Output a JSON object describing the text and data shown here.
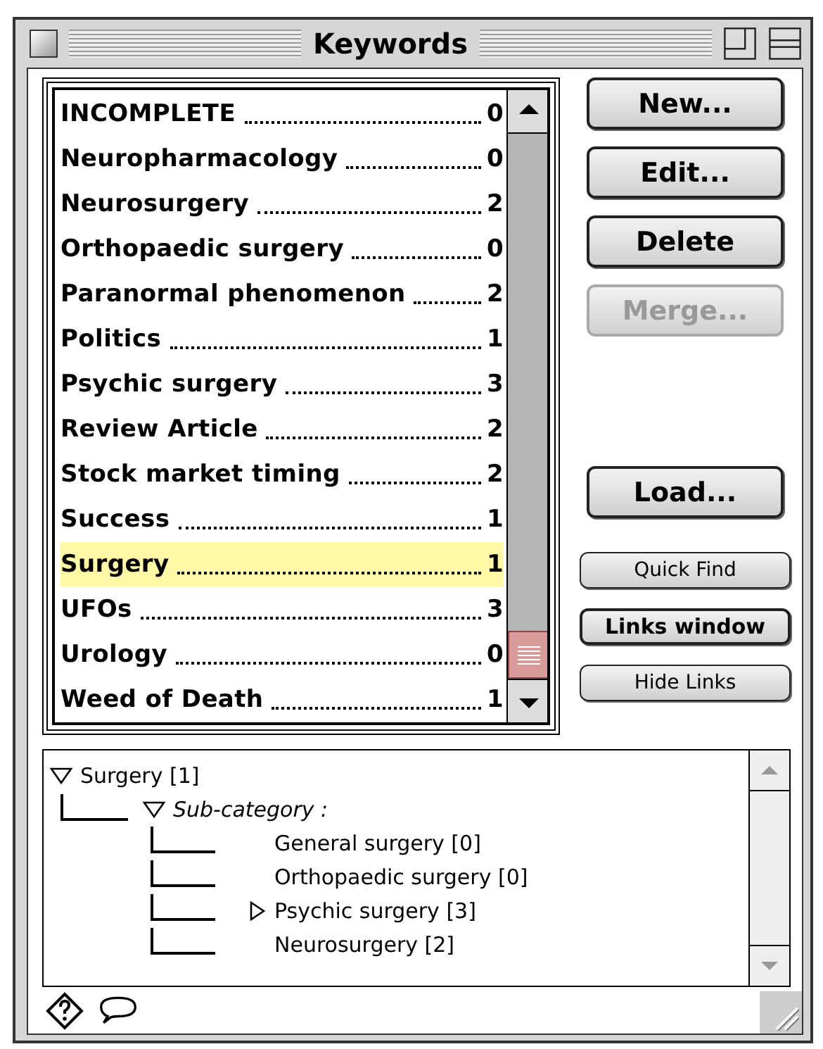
{
  "window": {
    "title": "Keywords"
  },
  "keywords": [
    {
      "name": "INCOMPLETE",
      "count": "0",
      "selected": false
    },
    {
      "name": "Neuropharmacology",
      "count": "0",
      "selected": false
    },
    {
      "name": "Neurosurgery",
      "count": "2",
      "selected": false
    },
    {
      "name": "Orthopaedic surgery",
      "count": "0",
      "selected": false
    },
    {
      "name": "Paranormal phenomenon",
      "count": "2",
      "selected": false
    },
    {
      "name": "Politics",
      "count": "1",
      "selected": false
    },
    {
      "name": "Psychic surgery",
      "count": "3",
      "selected": false
    },
    {
      "name": "Review Article",
      "count": "2",
      "selected": false
    },
    {
      "name": "Stock market timing",
      "count": "2",
      "selected": false
    },
    {
      "name": "Success",
      "count": "1",
      "selected": false
    },
    {
      "name": "Surgery",
      "count": "1",
      "selected": true
    },
    {
      "name": "UFOs",
      "count": "3",
      "selected": false
    },
    {
      "name": "Urology",
      "count": "0",
      "selected": false
    },
    {
      "name": "Weed of Death",
      "count": "1",
      "selected": false
    }
  ],
  "buttons": [
    {
      "label": "New...",
      "kind": "large",
      "disabled": false
    },
    {
      "label": "Edit...",
      "kind": "large",
      "disabled": false
    },
    {
      "label": "Delete",
      "kind": "large",
      "disabled": false
    },
    {
      "label": "Merge...",
      "kind": "large",
      "disabled": true
    },
    {
      "label": "Load...",
      "kind": "large",
      "disabled": false
    },
    {
      "label": "Quick Find",
      "kind": "small",
      "disabled": false
    },
    {
      "label": "Links window",
      "kind": "emphasized",
      "disabled": false
    },
    {
      "label": "Hide Links",
      "kind": "small",
      "disabled": false
    }
  ],
  "tree": [
    {
      "label": "Surgery [1]",
      "italic": false,
      "expanded": true,
      "children": [
        {
          "label": "Sub-category :",
          "italic": true,
          "expanded": true,
          "children": [
            {
              "label": "General surgery [0]",
              "italic": false
            },
            {
              "label": "Orthopaedic surgery [0]",
              "italic": false
            },
            {
              "label": "Psychic surgery [3]",
              "italic": false,
              "expanded": false
            },
            {
              "label": "Neurosurgery [2]",
              "italic": false
            }
          ]
        }
      ]
    }
  ]
}
